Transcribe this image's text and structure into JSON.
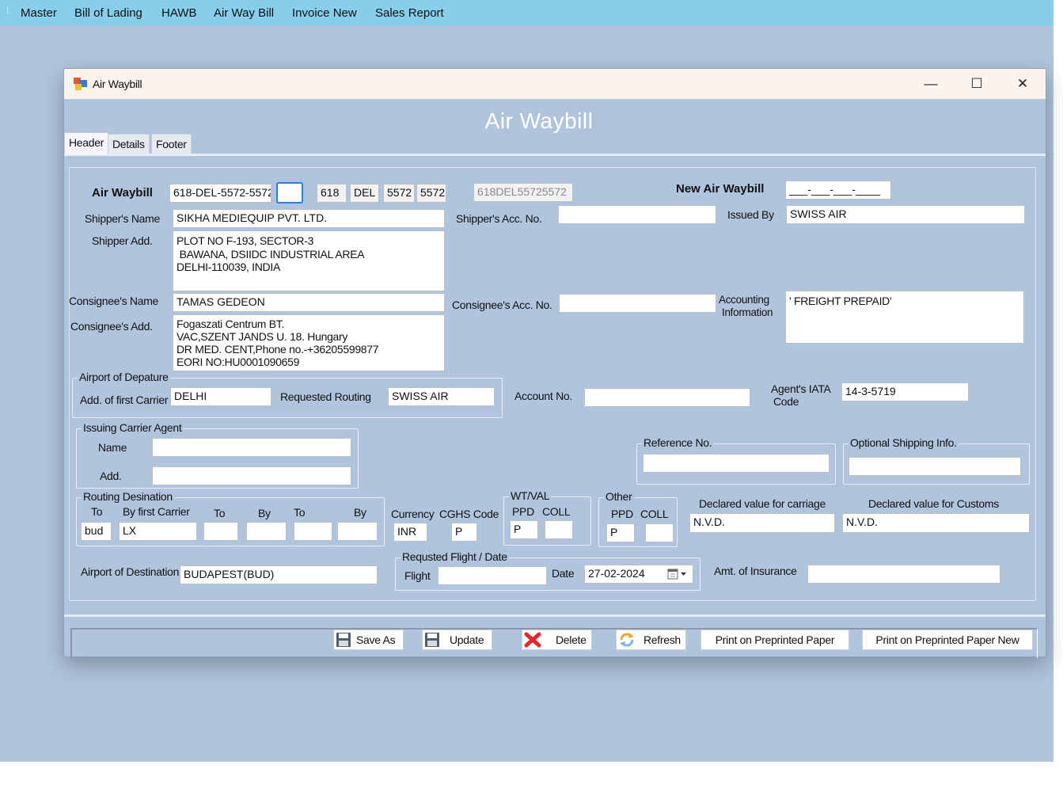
{
  "menu": {
    "items": [
      "Master",
      "Bill of Lading",
      "HAWB",
      "Air Way Bill",
      "Invoice New",
      "Sales Report"
    ]
  },
  "window": {
    "title": "Air Waybill",
    "min_glyph": "—",
    "max_glyph": "☐",
    "close_glyph": "✕"
  },
  "form": {
    "title": "Air Waybill",
    "tabs": [
      "Header",
      "Details",
      "Footer"
    ],
    "awb": {
      "label": "Air Waybill",
      "value": "618-DEL-5572-5572",
      "check": "",
      "part1": "618",
      "part2": "DEL",
      "part3": "5572",
      "part4": "5572",
      "combined": "618DEL55725572"
    },
    "new_awb": {
      "label": "New Air Waybill",
      "value": "___-___-___-____"
    },
    "shipper": {
      "name_label": "Shipper's Name",
      "name": "SIKHA MEDIEQUIP PVT. LTD.",
      "add_label": "Shipper Add.",
      "address": "PLOT NO F-193, SECTOR-3\n BAWANA, DSIIDC INDUSTRIAL AREA\nDELHI-110039, INDIA",
      "acc_label": "Shipper's Acc. No.",
      "acc": ""
    },
    "issued_by": {
      "label": "Issued By",
      "value": "SWISS AIR"
    },
    "consignee": {
      "name_label": "Consignee's Name",
      "name": "TAMAS GEDEON",
      "add_label": "Consignee's Add.",
      "address": "Fogaszati Centrum BT.\nVAC,SZENT JANDS U. 18. Hungary\nDR MED. CENT,Phone no.-+36205599877\nEORI NO:HU0001090659",
      "acc_label": "Consignee's Acc. No.",
      "acc": ""
    },
    "accounting": {
      "label1": "Accounting",
      "label2": "Information",
      "value": "' FREIGHT PREPAID'"
    },
    "departure": {
      "group": "Airport of Depature",
      "carrier_label": "Add. of first Carrier",
      "carrier": "DELHI",
      "routing_label": "Requested Routing",
      "routing": "SWISS AIR"
    },
    "account_no": {
      "label": "Account No.",
      "value": ""
    },
    "iata": {
      "label1": "Agent's IATA",
      "label2": "Code",
      "value": "14-3-5719"
    },
    "issuing_agent": {
      "group": "Issuing Carrier Agent",
      "name_label": "Name",
      "name": "",
      "add_label": "Add.",
      "add": ""
    },
    "reference": {
      "group": "Reference No.",
      "value": ""
    },
    "optional": {
      "group": "Optional Shipping Info.",
      "value": ""
    },
    "routing_dest": {
      "group": "Routing  Desination",
      "to_label": "To",
      "carrier_label": "By first Carrier",
      "to2_label": "To",
      "by2_label": "By",
      "to3_label": "To",
      "by3_label": "By",
      "to": "bud",
      "carrier": "LX",
      "to2": "",
      "by2": "",
      "to3": "",
      "by3": ""
    },
    "currency": {
      "label": "Currency",
      "value": "INR"
    },
    "cghs": {
      "label": "CGHS Code",
      "value": "P"
    },
    "wtval": {
      "group": "WT/VAL",
      "ppd_label": "PPD",
      "coll_label": "COLL",
      "ppd": "P",
      "coll": ""
    },
    "other": {
      "group": "Other",
      "ppd_label": "PPD",
      "coll_label": "COLL",
      "ppd": "P",
      "coll": ""
    },
    "declared_carriage": {
      "label": "Declared value for carriage",
      "value": "N.V.D."
    },
    "declared_customs": {
      "label": "Declared value for Customs",
      "value": "N.V.D."
    },
    "destination": {
      "label": "Airport of Destination",
      "value": "BUDAPEST(BUD)"
    },
    "flight": {
      "group": "Requsted Flight / Date",
      "flight_label": "Flight",
      "flight": "",
      "date_label": "Date",
      "date": "27-02-2024"
    },
    "insurance": {
      "label": "Amt. of Insurance",
      "value": ""
    }
  },
  "buttons": {
    "save_as": "Save As",
    "update": "Update",
    "delete": "Delete",
    "refresh": "Refresh",
    "print": "Print on Preprinted Paper",
    "print_new": "Print on Preprinted Paper New"
  },
  "colors": {
    "background": "#b0c4de",
    "menubar": "#87ceeb",
    "titlebar": "#fbf3ee",
    "delete_icon": "#e8262a"
  }
}
